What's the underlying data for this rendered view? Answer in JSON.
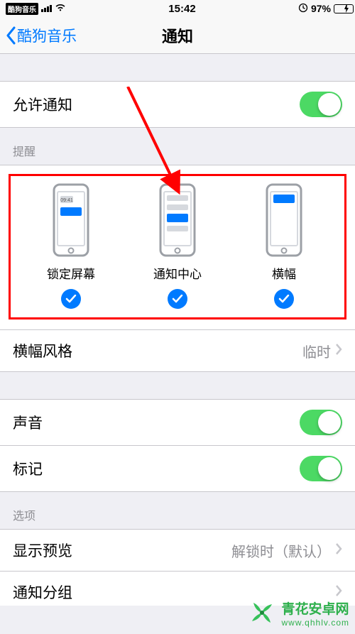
{
  "status": {
    "back_app": "酷狗音乐",
    "carrier_icon": "signal",
    "wifi_icon": "wifi",
    "time": "15:42",
    "lock_icon": "lock",
    "battery_pct": "97%",
    "battery_fill_pct": 97
  },
  "nav": {
    "back_label": "酷狗音乐",
    "title": "通知"
  },
  "rows": {
    "allow_notifications": "允许通知",
    "allow_on": true,
    "banner_style": {
      "label": "横幅风格",
      "value": "临时"
    },
    "sound": "声音",
    "sound_on": true,
    "badges": "标记",
    "badges_on": true,
    "show_previews": {
      "label": "显示预览",
      "value": "解锁时（默认）"
    },
    "grouping": "通知分组"
  },
  "headers": {
    "alerts": "提醒",
    "options": "选项"
  },
  "alerts": [
    {
      "key": "lock",
      "label": "锁定屏幕",
      "checked": true,
      "time_badge": "09:41"
    },
    {
      "key": "center",
      "label": "通知中心",
      "checked": true
    },
    {
      "key": "banner",
      "label": "横幅",
      "checked": true
    }
  ],
  "annotation": {
    "arrow": true,
    "highlight_box": true
  },
  "watermark": {
    "name": "青花安卓网",
    "url": "www.qhhlv.com"
  },
  "colors": {
    "tint": "#007aff",
    "switch_green": "#4cd964",
    "highlight_red": "#ff0000",
    "watermark_green": "#2fb04d"
  }
}
